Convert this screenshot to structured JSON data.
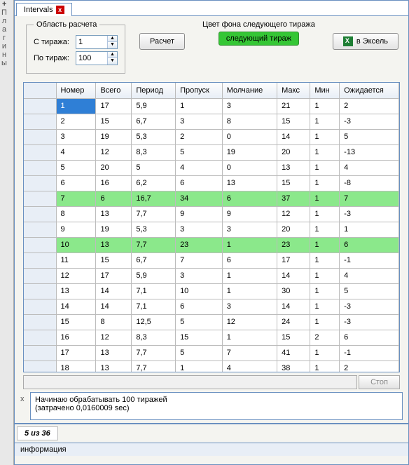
{
  "sidebar": {
    "label": "Плагины"
  },
  "tab": {
    "title": "Intervals"
  },
  "controls": {
    "fieldset_legend": "Область расчета",
    "from_label": "С тиража:",
    "to_label": "По тираж:",
    "from_value": "1",
    "to_value": "100",
    "calc_button": "Расчет",
    "bg_label": "Цвет фона следующего тиража",
    "next_button": "следующий тираж",
    "excel_button": "в Эксель"
  },
  "grid": {
    "headers": [
      "Номер",
      "Всего",
      "Период",
      "Пропуск",
      "Молчание",
      "Макс",
      "Мин",
      "Ожидается"
    ],
    "rows": [
      {
        "n": "1",
        "v": [
          "17",
          "5,9",
          "1",
          "3",
          "21",
          "1",
          "2"
        ],
        "sel": true
      },
      {
        "n": "2",
        "v": [
          "15",
          "6,7",
          "3",
          "8",
          "15",
          "1",
          "-3"
        ]
      },
      {
        "n": "3",
        "v": [
          "19",
          "5,3",
          "2",
          "0",
          "14",
          "1",
          "5"
        ]
      },
      {
        "n": "4",
        "v": [
          "12",
          "8,3",
          "5",
          "19",
          "20",
          "1",
          "-13"
        ]
      },
      {
        "n": "5",
        "v": [
          "20",
          "5",
          "4",
          "0",
          "13",
          "1",
          "4"
        ]
      },
      {
        "n": "6",
        "v": [
          "16",
          "6,2",
          "6",
          "13",
          "15",
          "1",
          "-8"
        ]
      },
      {
        "n": "7",
        "v": [
          "6",
          "16,7",
          "34",
          "6",
          "37",
          "1",
          "7"
        ],
        "hl": true
      },
      {
        "n": "8",
        "v": [
          "13",
          "7,7",
          "9",
          "9",
          "12",
          "1",
          "-3"
        ]
      },
      {
        "n": "9",
        "v": [
          "19",
          "5,3",
          "3",
          "3",
          "20",
          "1",
          "1"
        ]
      },
      {
        "n": "10",
        "v": [
          "13",
          "7,7",
          "23",
          "1",
          "23",
          "1",
          "6"
        ],
        "hl": true
      },
      {
        "n": "11",
        "v": [
          "15",
          "6,7",
          "7",
          "6",
          "17",
          "1",
          "-1"
        ]
      },
      {
        "n": "12",
        "v": [
          "17",
          "5,9",
          "3",
          "1",
          "14",
          "1",
          "4"
        ]
      },
      {
        "n": "13",
        "v": [
          "14",
          "7,1",
          "10",
          "1",
          "30",
          "1",
          "5"
        ]
      },
      {
        "n": "14",
        "v": [
          "14",
          "7,1",
          "6",
          "3",
          "14",
          "1",
          "-3"
        ]
      },
      {
        "n": "15",
        "v": [
          "8",
          "12,5",
          "5",
          "12",
          "24",
          "1",
          "-3"
        ]
      },
      {
        "n": "16",
        "v": [
          "12",
          "8,3",
          "15",
          "1",
          "15",
          "2",
          "6"
        ]
      },
      {
        "n": "17",
        "v": [
          "13",
          "7,7",
          "5",
          "7",
          "41",
          "1",
          "-1"
        ]
      },
      {
        "n": "18",
        "v": [
          "13",
          "7,7",
          "1",
          "4",
          "38",
          "1",
          "2"
        ]
      }
    ]
  },
  "footer": {
    "stop": "Стоп",
    "log_line1": "Начинаю обрабатывать 100 тиражей",
    "log_line2": "(затрачено 0,0160009 sec)"
  },
  "status": {
    "page": "5 из 36",
    "bottom_tab": "информация"
  }
}
